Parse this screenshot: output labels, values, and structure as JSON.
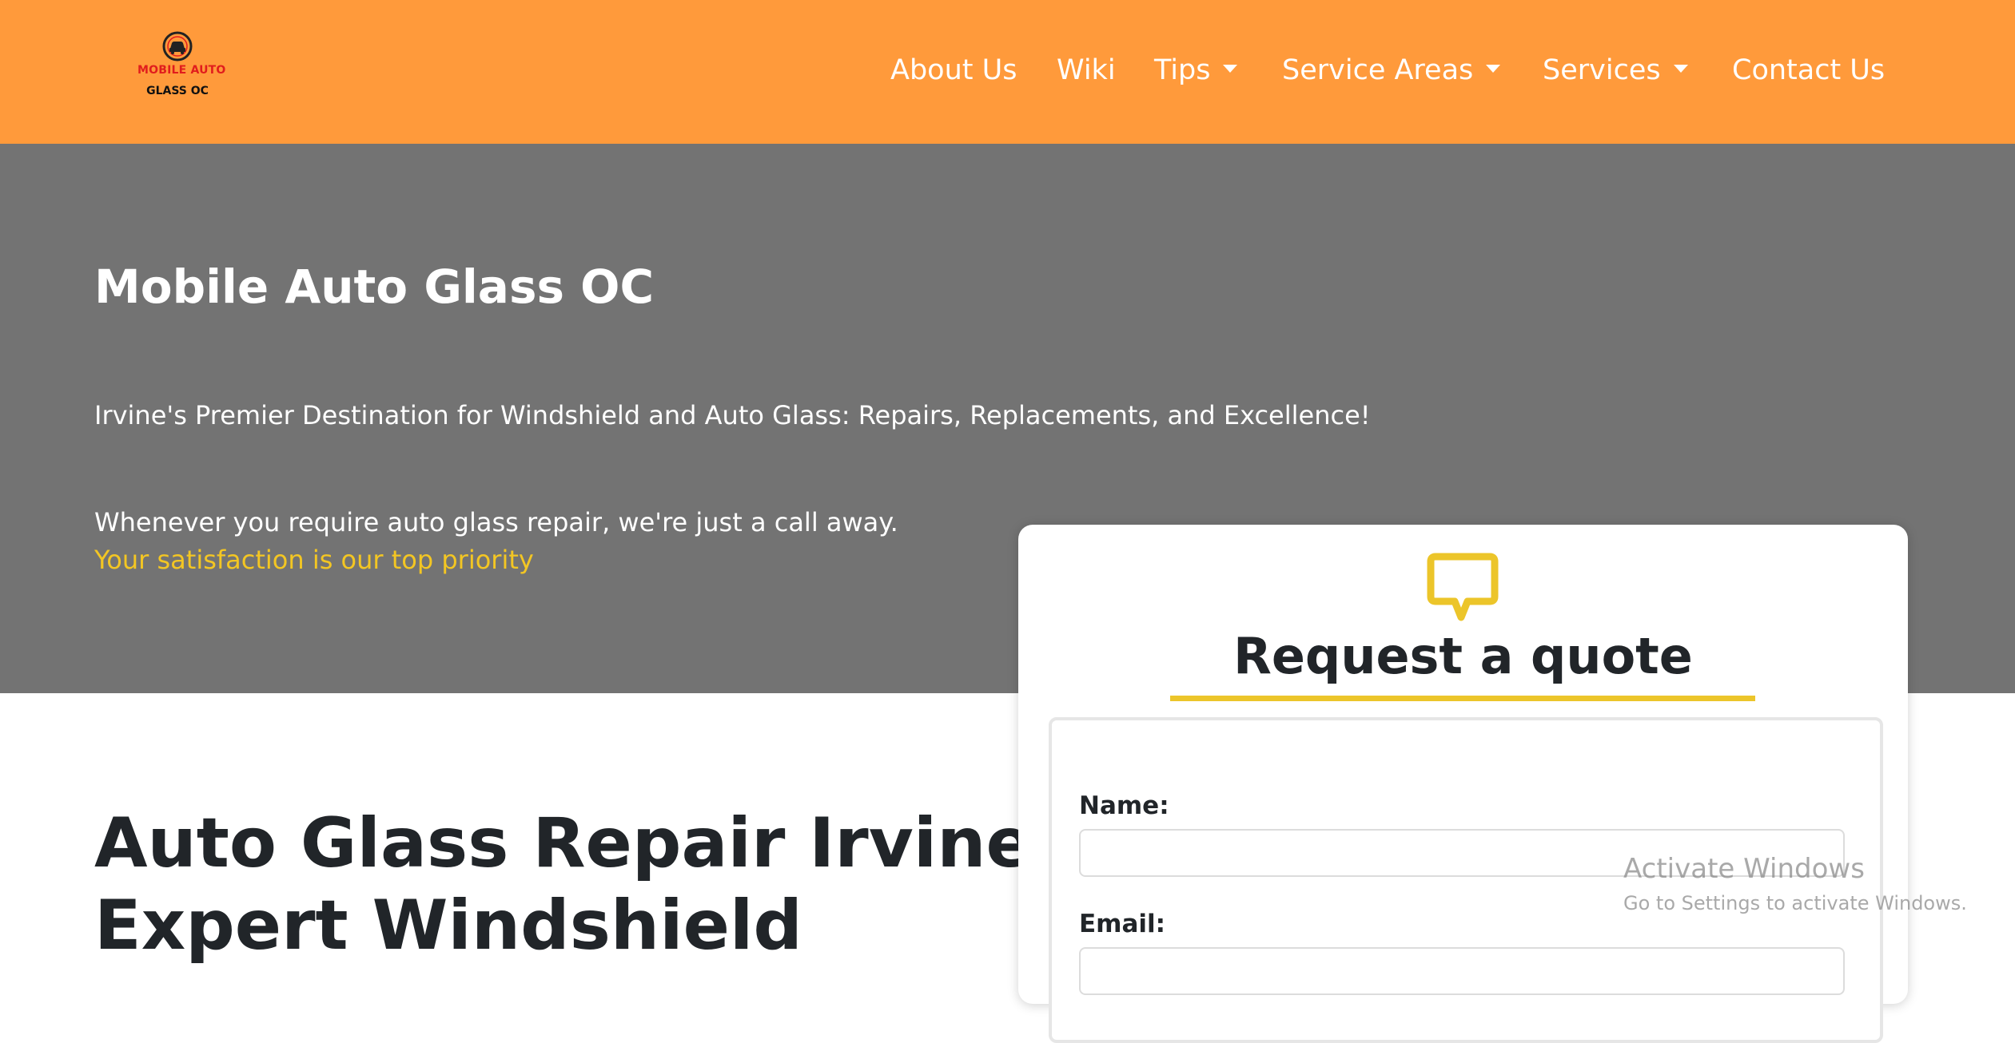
{
  "header": {
    "logo": {
      "line1": "MOBILE AUTO",
      "line2": "GLASS OC"
    },
    "nav": {
      "about": "About Us",
      "wiki": "Wiki",
      "tips": "Tips",
      "service_areas": "Service Areas",
      "services": "Services",
      "contact": "Contact Us"
    }
  },
  "hero": {
    "title": "Mobile Auto Glass OC",
    "tagline": "Irvine's Premier Destination for Windshield and Auto Glass: Repairs, Replacements, and Excellence!",
    "call_line": "Whenever you require auto glass repair, we're just a call away.",
    "priority_line": "Your satisfaction is our top priority"
  },
  "main": {
    "heading_line1": "Auto Glass Repair Irvine:",
    "heading_line2": "Expert Windshield"
  },
  "quote_form": {
    "icon": "chat-bubble-icon",
    "title": "Request a quote",
    "name_label": "Name:",
    "name_value": "",
    "email_label": "Email:",
    "email_value": ""
  },
  "os_watermark": {
    "title": "Activate Windows",
    "subtitle": "Go to Settings to activate Windows."
  },
  "colors": {
    "navbar": "#ff9a3b",
    "hero_bg": "#737373",
    "accent_yellow": "#f3c623",
    "heading_dark": "#212529"
  }
}
